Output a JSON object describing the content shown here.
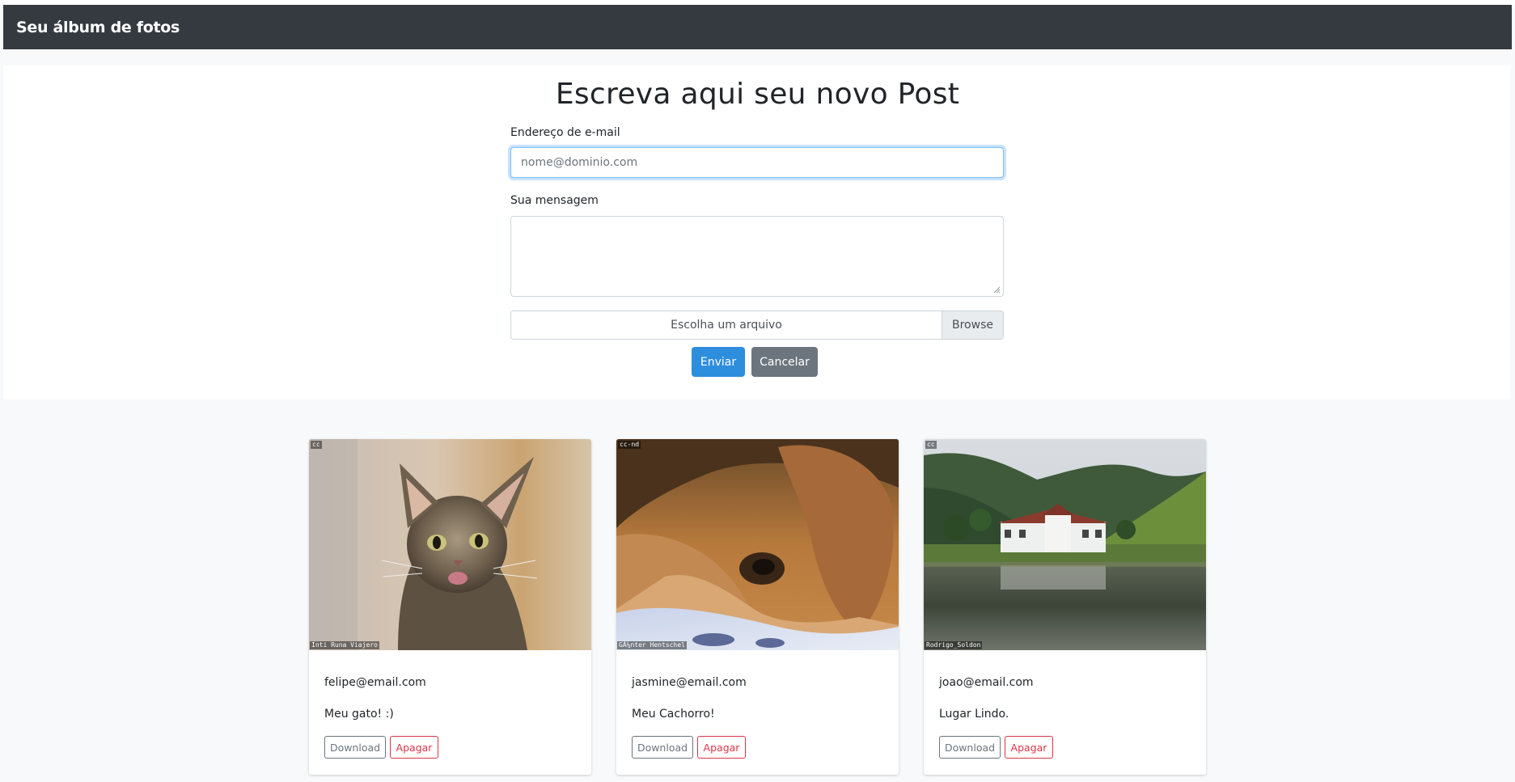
{
  "navbar": {
    "brand": "Seu álbum de fotos"
  },
  "form": {
    "title": "Escreva aqui seu novo Post",
    "email_label": "Endereço de e-mail",
    "email_placeholder": "nome@dominio.com",
    "email_value": "",
    "message_label": "Sua mensagem",
    "message_value": "",
    "file_label": "Escolha um arquivo",
    "browse_label": "Browse",
    "send_label": "Enviar",
    "cancel_label": "Cancelar"
  },
  "posts": [
    {
      "email": "felipe@email.com",
      "message": "Meu gato! :)",
      "license": "cc",
      "credit": "Inti Runa Viajero",
      "image": "cat-photo",
      "download_label": "Download",
      "delete_label": "Apagar"
    },
    {
      "email": "jasmine@email.com",
      "message": "Meu Cachorro!",
      "license": "cc-nd",
      "credit": "GÃ¼nter Hentschel",
      "image": "dog-photo",
      "download_label": "Download",
      "delete_label": "Apagar"
    },
    {
      "email": "joao@email.com",
      "message": "Lugar Lindo.",
      "license": "cc",
      "credit": "Rodrigo_Soldon",
      "image": "lake-photo",
      "download_label": "Download",
      "delete_label": "Apagar"
    }
  ],
  "colors": {
    "navbar": "#343a40",
    "primary": "#2e8ede",
    "secondary": "#6c757d",
    "danger": "#dc3545"
  }
}
